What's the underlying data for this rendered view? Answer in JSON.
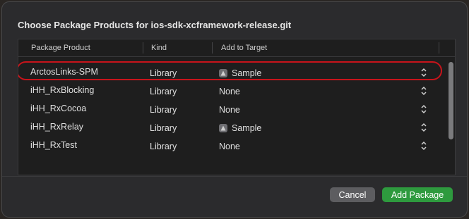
{
  "dialog": {
    "title": "Choose Package Products for ios-sdk-xcframework-release.git"
  },
  "table": {
    "columns": [
      "Package Product",
      "Kind",
      "Add to Target"
    ],
    "rows": [
      {
        "product": "ArctosLinks-SPM",
        "kind": "Library",
        "target": "Sample",
        "target_icon": "app-icon",
        "highlighted": true
      },
      {
        "product": "iHH_RxBlocking",
        "kind": "Library",
        "target": "None",
        "target_icon": null
      },
      {
        "product": "iHH_RxCocoa",
        "kind": "Library",
        "target": "None",
        "target_icon": null
      },
      {
        "product": "iHH_RxRelay",
        "kind": "Library",
        "target": "Sample",
        "target_icon": "app-icon"
      },
      {
        "product": "iHH_RxTest",
        "kind": "Library",
        "target": "None",
        "target_icon": null
      }
    ]
  },
  "footer": {
    "cancel_label": "Cancel",
    "add_label": "Add Package"
  },
  "colors": {
    "highlight_ring": "#c8141b",
    "primary_button": "#2e9a3e"
  }
}
